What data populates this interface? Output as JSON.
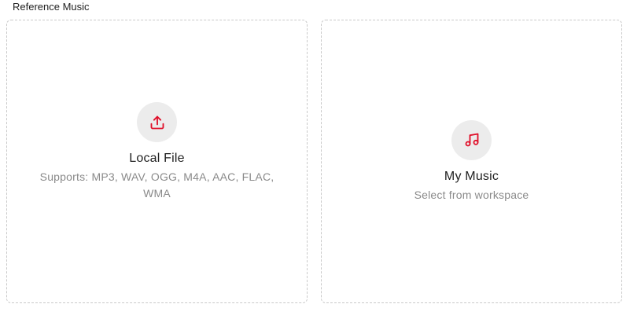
{
  "section": {
    "label": "Reference Music"
  },
  "cards": {
    "local": {
      "icon": "upload-icon",
      "title": "Local File",
      "subtitle": "Supports: MP3, WAV, OGG, M4A, AAC, FLAC, WMA"
    },
    "mymusic": {
      "icon": "music-note-icon",
      "title": "My Music",
      "subtitle": "Select from workspace"
    }
  },
  "colors": {
    "accent": "#e0102a",
    "icon_bg": "#ececec",
    "border": "#c9c9c9",
    "subtext": "#8a8a8a"
  }
}
